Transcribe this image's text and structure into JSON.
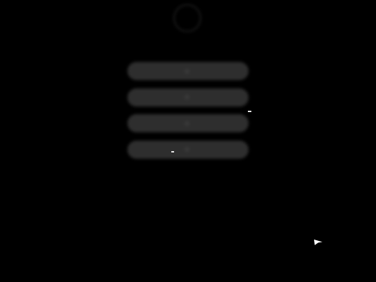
{
  "session": {
    "username": "",
    "avatar_icon": "user-avatar-icon"
  },
  "menu": {
    "items": [
      {
        "id": "switch-user",
        "label": "",
        "icon": "switch-user-icon"
      },
      {
        "id": "log-out",
        "label": "",
        "icon": "logout-icon"
      },
      {
        "id": "sleep",
        "label": "",
        "icon": "sleep-icon"
      },
      {
        "id": "cancel",
        "label": "",
        "icon": "cancel-icon"
      }
    ]
  },
  "colors": {
    "background": "#000000",
    "button": "#2e2e2e",
    "text": "#5c5c5c"
  }
}
